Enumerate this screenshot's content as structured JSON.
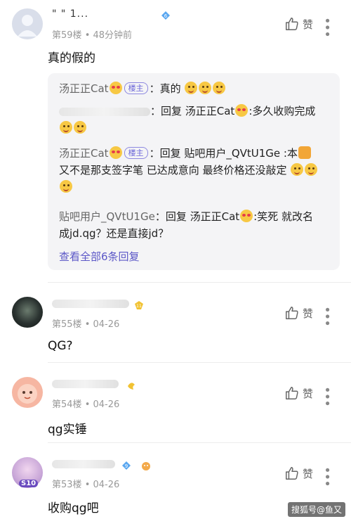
{
  "posts": [
    {
      "username": "\"          \" 1...",
      "floor": "第59楼",
      "time": "48分钟前",
      "like_label": "赞",
      "content": "真的假的",
      "replies": [
        {
          "name": "汤正正Cat",
          "tag": "楼主",
          "text": "：真的"
        },
        {
          "name": "",
          "text": "：回复 汤正正Cat",
          "text2": ":多久收购完成"
        },
        {
          "name": "汤正正Cat",
          "tag": "楼主",
          "text": "：回复 贴吧用户_QVtU1Ge :本",
          "line2": "又不是那支签字笔 已达成意向 最终价格还没敲定"
        },
        {
          "name": "贴吧用户_QVtU1Ge",
          "text": "：回复 汤正正Cat",
          "text2": ":笑死 就改名",
          "line2": "成jd.qg？还是直接jd？"
        }
      ],
      "view_all": "查看全部6条回复"
    },
    {
      "username": "",
      "floor": "第55楼",
      "time": "04-26",
      "like_label": "赞",
      "content": "QG?"
    },
    {
      "username": "",
      "floor": "第54楼",
      "time": "04-26",
      "like_label": "赞",
      "content": "qg实锤"
    },
    {
      "username": "",
      "floor": "第53楼",
      "time": "04-26",
      "like_label": "赞",
      "content": "收购qg吧",
      "avatar_badge": "S10"
    }
  ],
  "meta_separator": "•",
  "watermark": "搜狐号@鱼又",
  "colors": {
    "accent": "#5b57c7",
    "meta": "#999999",
    "reply_bg": "#f4f4f6"
  }
}
